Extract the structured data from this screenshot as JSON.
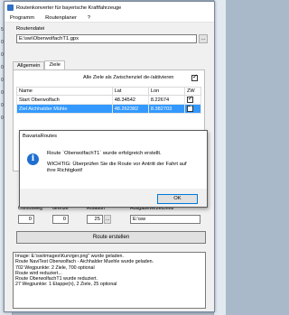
{
  "window": {
    "title": "Routenkonverter für bayerische Kraftfahrzeuge"
  },
  "menu": [
    "Programm",
    "Routenplaner",
    "?"
  ],
  "route_file": {
    "label": "Routendatei",
    "value": "E:\\sw\\OberwolfachT1.gpx",
    "browse_label": "..."
  },
  "tabs": [
    {
      "label": "Allgemein",
      "active": false
    },
    {
      "label": "Ziele",
      "active": true
    }
  ],
  "stopover_toggle": {
    "label": "Alle Ziele als Zwischenziel de-/aktivieren",
    "checked": true
  },
  "table": {
    "columns": [
      "Name",
      "Lat",
      "Lon",
      "ZW"
    ],
    "rows": [
      {
        "name": "Start Oberwolfach",
        "lat": "48.34542",
        "lon": "8.22674",
        "zw": true,
        "selected": false
      },
      {
        "name": "Ziel Aichhalder Mühle",
        "lat": "48.262382",
        "lon": "8.382703",
        "zw": true,
        "selected": true
      }
    ]
  },
  "lower_fields": {
    "labels": [
      "Osmosweg",
      "Grenze",
      "Rotation",
      "Ausgabeverzeichnis"
    ],
    "values": [
      "0",
      "0",
      "25",
      "E:\\sw"
    ],
    "browse_label": "..."
  },
  "create_button": "Route erstellen",
  "log_lines": [
    "Image: E:\\sw\\images\\Kurviger.png\" wurde geladen.",
    "Route NaviTest Oberwolfach - Aichhalder Muehle wurde geladen.",
    "702 Wegpunkte: 2 Ziele, 700 optional",
    "Route wird reduziert...",
    "Route OberwolfachT1 wurde reduziert.",
    "27 Wegpunkte: 1 Etappe(n), 2 Ziele, 25 optional"
  ],
  "dialog": {
    "title": "BavariaRoutes",
    "message": "Route `OberwolfachT1` wurde erfolgreich erstellt.",
    "warning_line1": "WICHTIG: Überprüfen Sie die Route vor Antritt der Fahrt auf",
    "warning_line2": "ihre Richtigkeit!",
    "ok_label": "OK"
  },
  "background_left": [
    "5",
    "0",
    "0",
    "0",
    "0",
    "0",
    "0",
    "0"
  ],
  "colors": {
    "accent": "#3399ff",
    "info": "#1f6fd1"
  }
}
